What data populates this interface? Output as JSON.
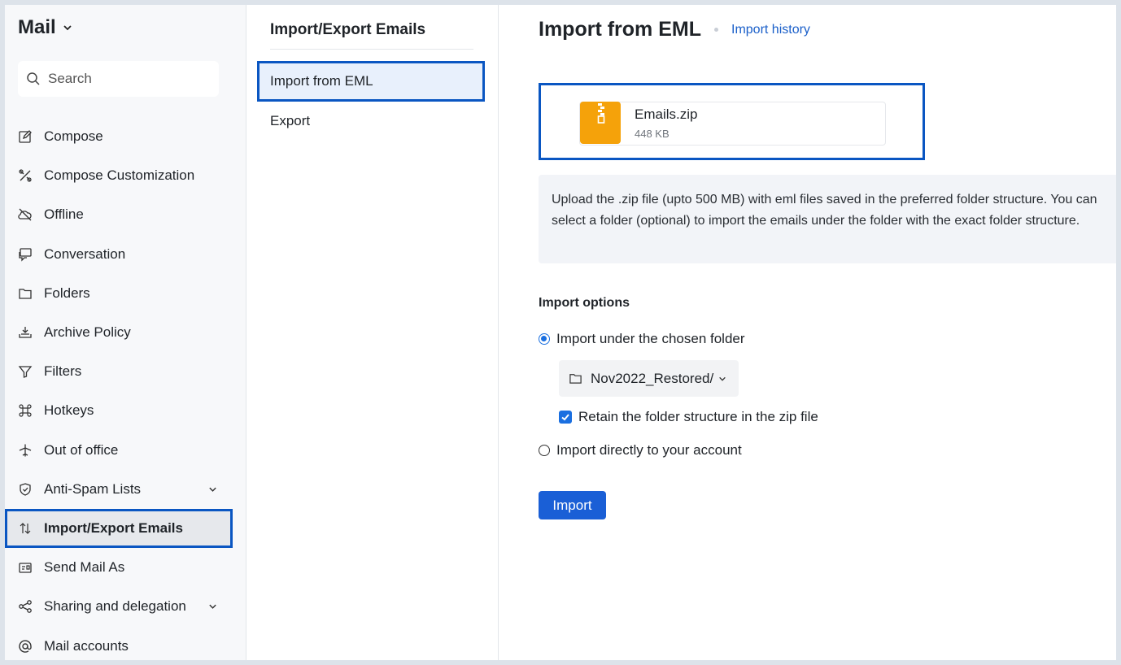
{
  "app": {
    "title": "Mail"
  },
  "search": {
    "placeholder": "Search"
  },
  "sidebar": {
    "items": [
      {
        "label": "Compose",
        "icon": "compose-icon"
      },
      {
        "label": "Compose Customization",
        "icon": "customization-icon"
      },
      {
        "label": "Offline",
        "icon": "offline-icon"
      },
      {
        "label": "Conversation",
        "icon": "conversation-icon"
      },
      {
        "label": "Folders",
        "icon": "folder-icon"
      },
      {
        "label": "Archive Policy",
        "icon": "archive-icon"
      },
      {
        "label": "Filters",
        "icon": "filter-icon"
      },
      {
        "label": "Hotkeys",
        "icon": "command-key-icon"
      },
      {
        "label": "Out of office",
        "icon": "airplane-icon"
      },
      {
        "label": "Anti-Spam Lists",
        "icon": "shield-icon",
        "expandable": true
      },
      {
        "label": "Import/Export Emails",
        "icon": "import-export-icon",
        "active": true
      },
      {
        "label": "Send Mail As",
        "icon": "send-mail-as-icon"
      },
      {
        "label": "Sharing and delegation",
        "icon": "share-icon",
        "expandable": true
      },
      {
        "label": "Mail accounts",
        "icon": "at-icon"
      }
    ]
  },
  "middle": {
    "title": "Import/Export Emails",
    "items": [
      {
        "label": "Import from EML",
        "active": true
      },
      {
        "label": "Export"
      }
    ]
  },
  "main": {
    "title": "Import from EML",
    "history_link": "Import history",
    "file": {
      "name": "Emails.zip",
      "size": "448 KB",
      "icon": "zip-file-icon"
    },
    "info": "Upload the .zip file (upto 500 MB) with eml files saved in the preferred folder structure. You can select a folder (optional) to import the emails under the folder with the exact folder structure.",
    "options_title": "Import options",
    "option_chosen_folder": "Import under the chosen folder",
    "folder_select": "Nov2022_Restored/",
    "retain_checkbox": "Retain the folder structure in the zip file",
    "option_direct": "Import directly to your account",
    "import_button": "Import"
  },
  "colors": {
    "accent": "#1a5fd6",
    "highlight_border": "#0a56c2",
    "zip_icon": "#f5a20a"
  }
}
